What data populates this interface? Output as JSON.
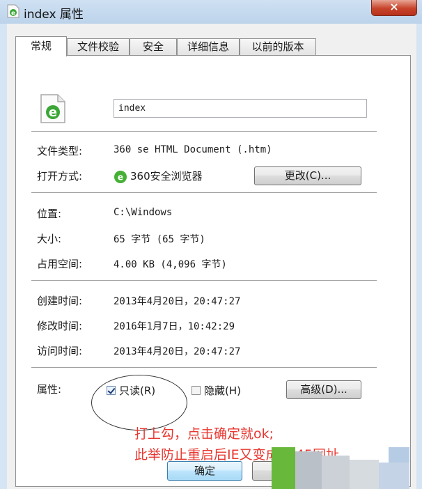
{
  "window": {
    "title": "index 属性",
    "close_label": "×"
  },
  "tabs": [
    {
      "label": "常规",
      "active": true
    },
    {
      "label": "文件校验",
      "active": false
    },
    {
      "label": "安全",
      "active": false
    },
    {
      "label": "详细信息",
      "active": false
    },
    {
      "label": "以前的版本",
      "active": false
    }
  ],
  "general": {
    "file_name": "index",
    "file_type_label": "文件类型:",
    "file_type_value": "360 se HTML Document (.htm)",
    "open_with_label": "打开方式:",
    "open_with_value": "360安全浏览器",
    "change_button": "更改(C)...",
    "location_label": "位置:",
    "location_value": "C:\\Windows",
    "size_label": "大小:",
    "size_value": "65 字节 (65 字节)",
    "disk_size_label": "占用空间:",
    "disk_size_value": "4.00 KB (4,096 字节)",
    "created_label": "创建时间:",
    "created_value": "2013年4月20日，20:47:27",
    "modified_label": "修改时间:",
    "modified_value": "2016年1月7日，10:42:29",
    "accessed_label": "访问时间:",
    "accessed_value": "2013年4月20日，20:47:27",
    "attributes_label": "属性:",
    "readonly_label": "只读(R)",
    "readonly_checked": true,
    "hidden_label": "隐藏(H)",
    "hidden_checked": false,
    "advanced_button": "高级(D)..."
  },
  "annotation": {
    "line1": "打上勾，点击确定就ok;",
    "line2": "此举防止重启后IE又变成2345网址。",
    "color": "#e8362f"
  },
  "footer": {
    "ok_button": "确定"
  },
  "icons": {
    "title": "ie-file-icon",
    "file": "ie-file-icon",
    "browser": "360-browser-icon"
  }
}
